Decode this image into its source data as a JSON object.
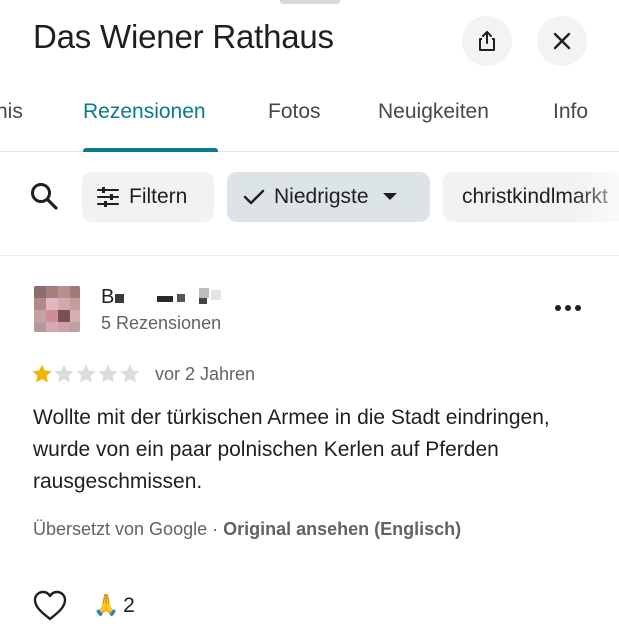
{
  "header": {
    "title": "Das Wiener Rathaus",
    "share_icon": "share-icon",
    "close_icon": "close-icon"
  },
  "tabs": [
    {
      "label": "nis",
      "active": false
    },
    {
      "label": "Rezensionen",
      "active": true
    },
    {
      "label": "Fotos",
      "active": false
    },
    {
      "label": "Neuigkeiten",
      "active": false
    },
    {
      "label": "Info",
      "active": false
    }
  ],
  "filters": {
    "search_icon": "search-icon",
    "filter_label": "Filtern",
    "sort_label": "Niedrigste",
    "topic_label": "christkindlmarkt"
  },
  "review": {
    "reviewer_name": "B",
    "review_count": "5 Rezensionen",
    "rating": 1,
    "max_rating": 5,
    "date": "vor 2 Jahren",
    "text": "Wollte mit der türkischen Armee in die Stadt eindringen, wurde von ein paar polnischen Kerlen auf Pferden rausgeschmissen.",
    "translated_by": "Übersetzt von Google · ",
    "original_link": "Original ansehen (Englisch)",
    "reaction_emoji": "🙏",
    "reaction_count": "2"
  },
  "colors": {
    "accent": "#0b7a8a",
    "star_filled": "#f5b301",
    "star_empty": "#dadce0"
  }
}
